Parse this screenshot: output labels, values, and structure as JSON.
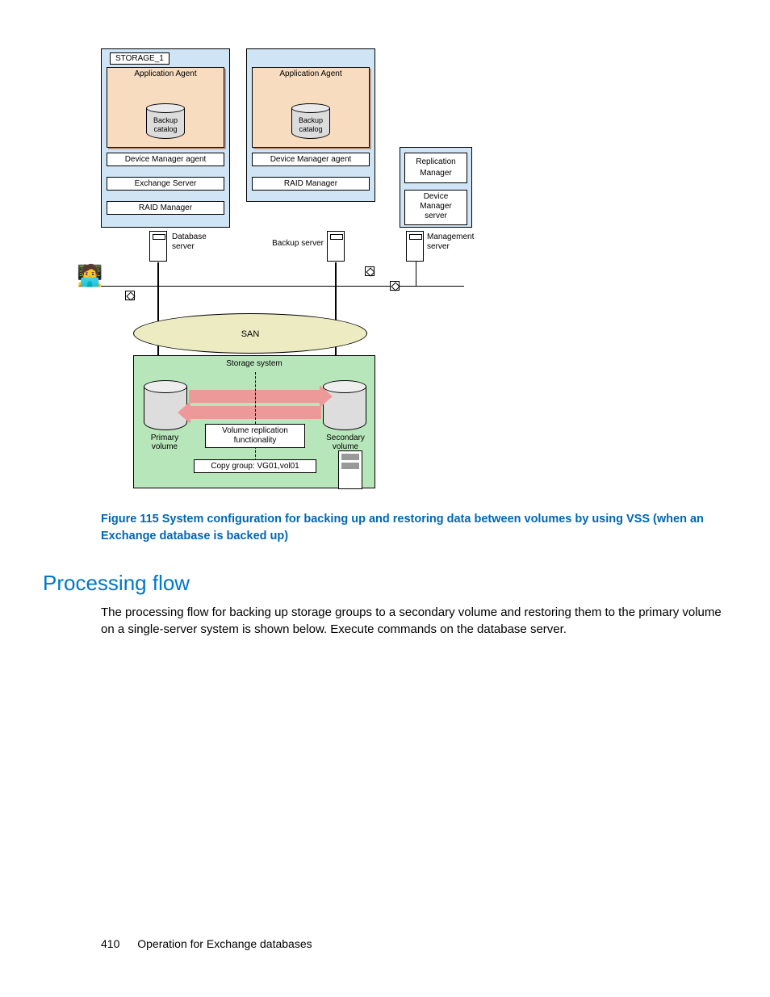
{
  "diagram": {
    "storage_label": "STORAGE_1",
    "app_agent": "Application Agent",
    "backup_catalog": "Backup\ncatalog",
    "device_manager_agent": "Device Manager agent",
    "exchange_server": "Exchange Server",
    "raid_manager": "RAID Manager",
    "replication_manager": "Replication\nManager",
    "device_manager_server": "Device\nManager\nserver",
    "database_server": "Database\nserver",
    "backup_server": "Backup server",
    "management_server": "Management\nserver",
    "san": "SAN",
    "storage_system": "Storage system",
    "primary_volume": "Primary\nvolume",
    "secondary_volume": "Secondary\nvolume",
    "volume_replication": "Volume replication\nfunctionality",
    "copy_group": "Copy group: VG01,vol01"
  },
  "figure_caption": "Figure 115 System configuration for backing up and restoring data between volumes by using VSS (when an Exchange database is backed up)",
  "heading": "Processing flow",
  "paragraph": "The processing flow for backing up storage groups to a secondary volume and restoring them to the primary volume on a single-server system is shown below. Execute commands on the database server.",
  "footer": {
    "page_number": "410",
    "section": "Operation for Exchange databases"
  }
}
